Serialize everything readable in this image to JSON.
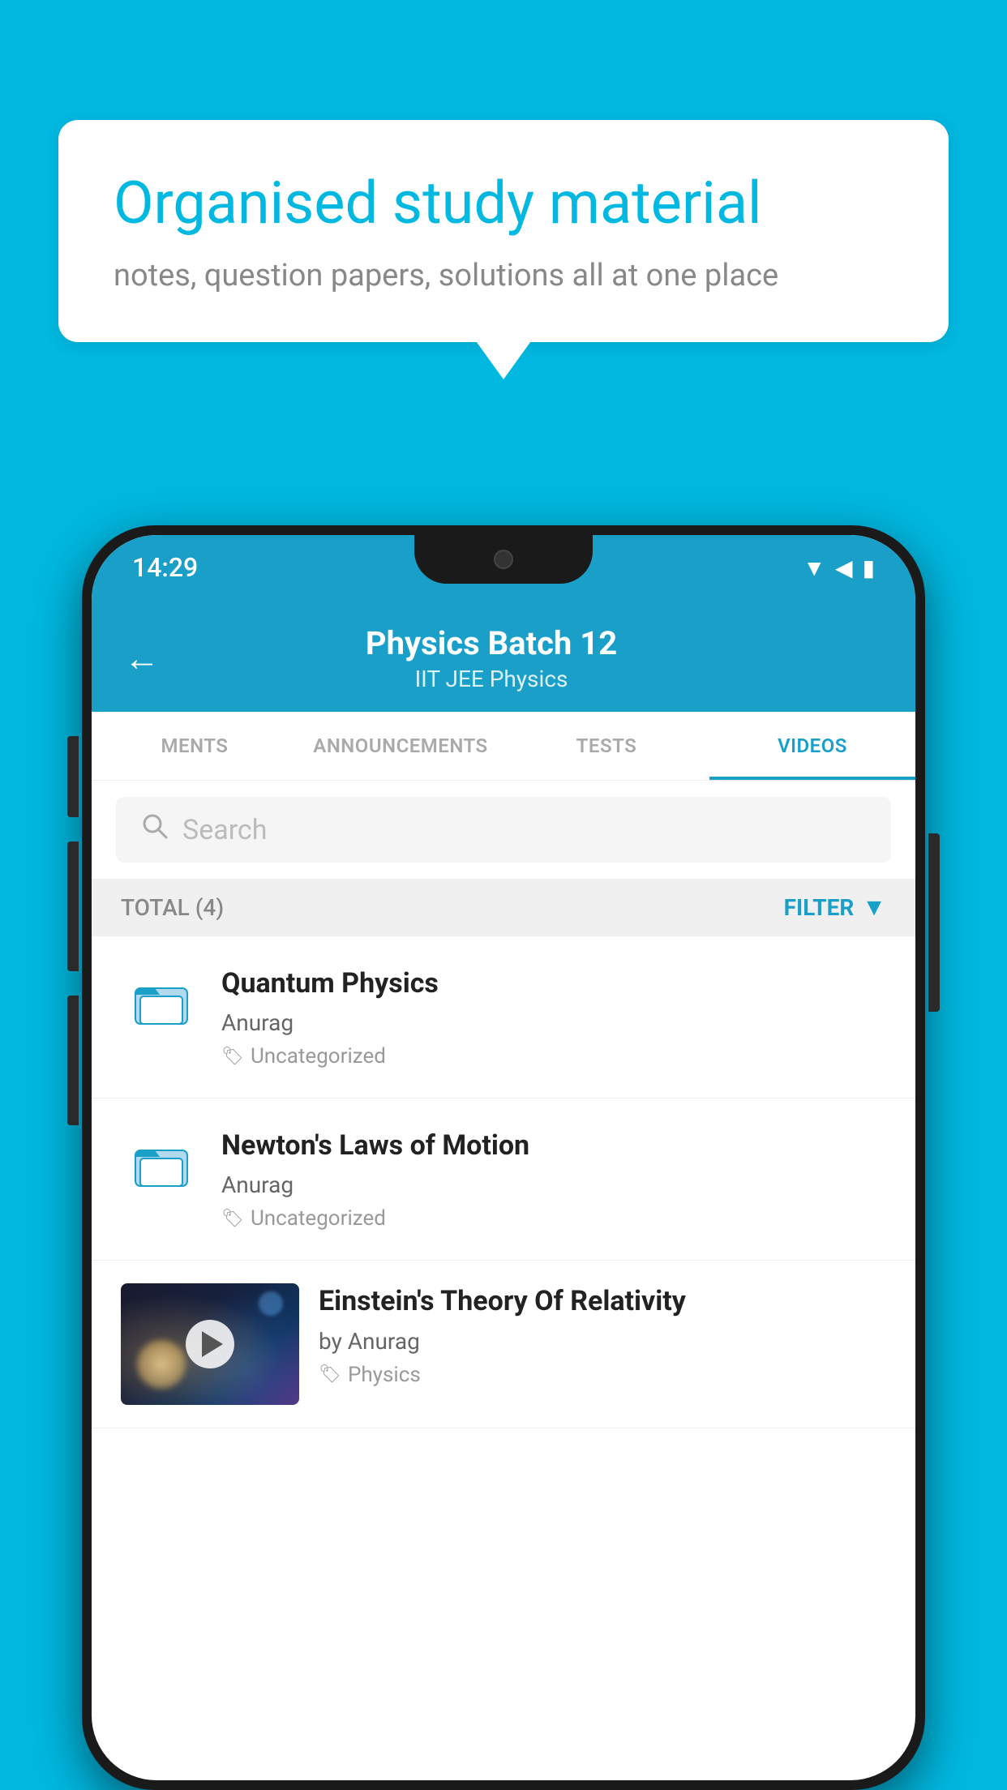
{
  "bubble": {
    "title": "Organised study material",
    "subtitle": "notes, question papers, solutions all at one place"
  },
  "status_bar": {
    "time": "14:29"
  },
  "header": {
    "title": "Physics Batch 12",
    "subtitle": "IIT JEE   Physics",
    "back_label": "←"
  },
  "tabs": [
    {
      "label": "MENTS",
      "active": false
    },
    {
      "label": "ANNOUNCEMENTS",
      "active": false
    },
    {
      "label": "TESTS",
      "active": false
    },
    {
      "label": "VIDEOS",
      "active": true
    }
  ],
  "search": {
    "placeholder": "Search"
  },
  "filter_bar": {
    "total_label": "TOTAL (4)",
    "filter_label": "FILTER"
  },
  "videos": [
    {
      "title": "Quantum Physics",
      "author": "Anurag",
      "tag": "Uncategorized",
      "has_thumb": false
    },
    {
      "title": "Newton's Laws of Motion",
      "author": "Anurag",
      "tag": "Uncategorized",
      "has_thumb": false
    },
    {
      "title": "Einstein's Theory Of Relativity",
      "author": "by Anurag",
      "tag": "Physics",
      "has_thumb": true
    }
  ]
}
